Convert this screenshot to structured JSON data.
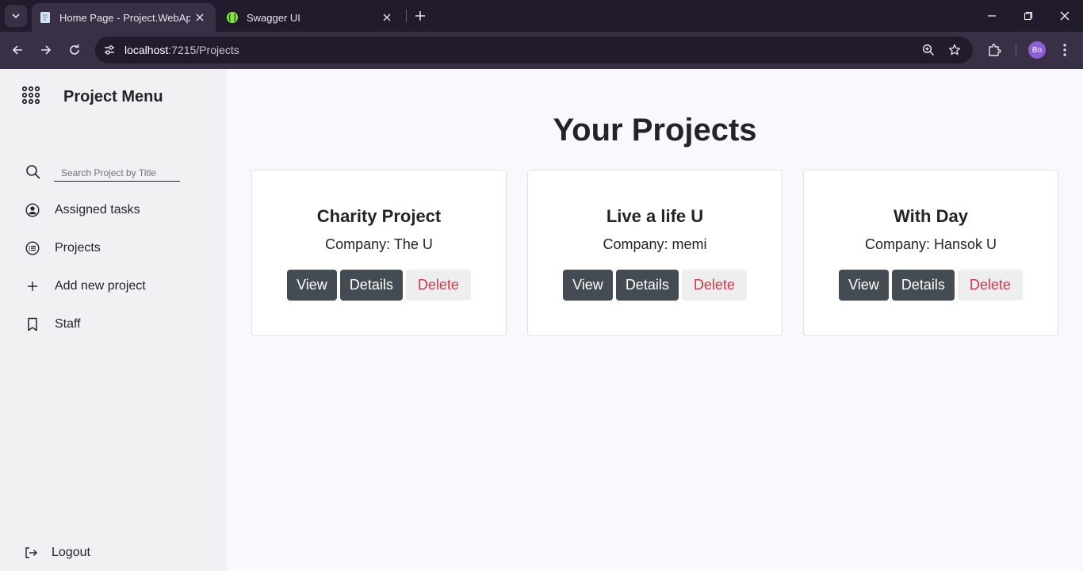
{
  "browser": {
    "tabs": [
      {
        "title": "Home Page - Project.WebApp",
        "active": true
      },
      {
        "title": "Swagger UI",
        "active": false
      }
    ],
    "url_host": "localhost",
    "url_path": ":7215/Projects",
    "profile_initials": "Bo"
  },
  "sidebar": {
    "title": "Project Menu",
    "search_placeholder": "Search Project by Title",
    "items": [
      {
        "label": "Assigned tasks",
        "icon": "user-circle-icon"
      },
      {
        "label": "Projects",
        "icon": "list-circle-icon"
      },
      {
        "label": "Add new project",
        "icon": "plus-icon"
      },
      {
        "label": "Staff",
        "icon": "bookmark-icon"
      }
    ],
    "logout_label": "Logout"
  },
  "main": {
    "title": "Your Projects",
    "projects": [
      {
        "title": "Charity Project",
        "company": "Company: The U"
      },
      {
        "title": "Live a life U",
        "company": "Company: memi"
      },
      {
        "title": "With Day",
        "company": "Company: Hansok U"
      }
    ],
    "buttons": {
      "view": "View",
      "details": "Details",
      "delete": "Delete"
    }
  },
  "colors": {
    "chrome_dark": "#221a2d",
    "chrome": "#3a3046",
    "sidebar_bg": "#f1f1f3",
    "page_bg": "#f8f9fc",
    "button_dark": "#454b53",
    "delete_text": "#dc3545"
  }
}
